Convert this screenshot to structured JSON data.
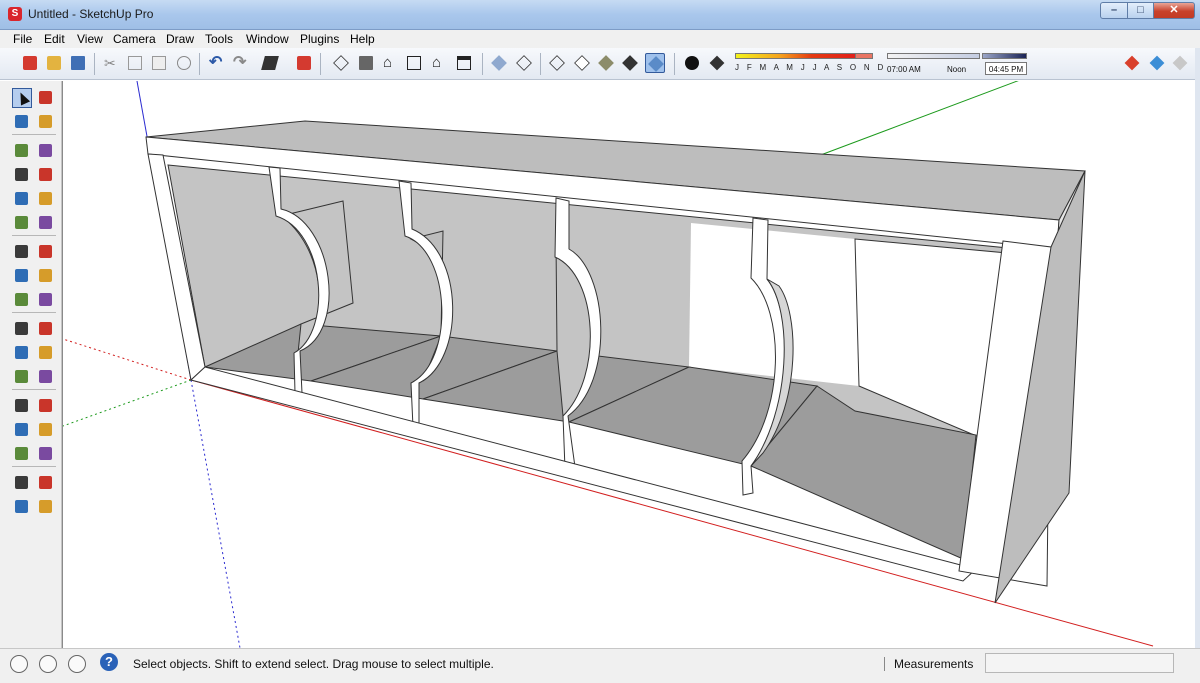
{
  "window": {
    "title": "Untitled - SketchUp Pro",
    "app_icon": "sketchup-logo-icon"
  },
  "menu": [
    "File",
    "Edit",
    "View",
    "Camera",
    "Draw",
    "Tools",
    "Window",
    "Plugins",
    "Help"
  ],
  "toolbar": {
    "months_label": "J F M A M J J A S O N D",
    "time_start": "07:00 AM",
    "time_noon": "Noon",
    "time_value": "04:45 PM",
    "active_tool": "shaded-with-textures-icon"
  },
  "left_tools": [
    "select-icon",
    "component-icon",
    "paint-bucket-icon",
    "eraser-icon",
    "rectangle-icon",
    "line-icon",
    "circle-icon",
    "freehand-icon",
    "polygon-icon",
    "arc-icon",
    "pie-icon",
    "two-point-arc-icon",
    "move-icon",
    "push-pull-icon",
    "rotate-icon",
    "follow-me-icon",
    "scale-icon",
    "offset-icon",
    "tape-measure-icon",
    "dimension-icon",
    "protractor-icon",
    "text-icon",
    "axes-icon",
    "3d-text-icon",
    "orbit-icon",
    "pan-icon",
    "zoom-icon",
    "zoom-window-icon",
    "zoom-extents-icon",
    "previous-view-icon",
    "position-camera-icon",
    "look-around-icon",
    "walk-icon",
    "section-plane-icon"
  ],
  "status": {
    "text": "Select objects. Shift to extend select. Drag mouse to select multiple.",
    "measurements_label": "Measurements",
    "measurements_value": ""
  },
  "colors": {
    "axis_red": "#d21f1f",
    "axis_green": "#1c9a1c",
    "axis_blue": "#2a2ad0",
    "face_gray": "#bdbdbd",
    "face_dark": "#9c9c9c"
  }
}
